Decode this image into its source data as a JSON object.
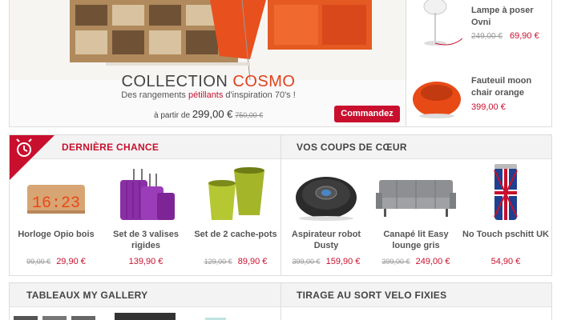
{
  "hero": {
    "title_plain": "COLLECTION ",
    "title_accent": "COSMO",
    "subtitle_1": "Des rangements ",
    "subtitle_hl": "pétillants",
    "subtitle_2": " d'inspiration 70's !",
    "price_prefix": "à partir de ",
    "price": "299,00 €",
    "old_price": "750,00 €",
    "order_label": "Commandez"
  },
  "side_products": [
    {
      "name": "Lampe à poser Ovni",
      "old_price": "249,00 €",
      "price": "69,90 €"
    },
    {
      "name": "Fauteuil moon chair orange",
      "old_price": "",
      "price": "399,00 €"
    }
  ],
  "last_chance": {
    "title": "DERNIÈRE CHANCE",
    "products": [
      {
        "name": "Horloge Opio bois",
        "old_price": "99,00 €",
        "price": "29,90 €",
        "display": "16:23"
      },
      {
        "name": "Set de 3 valises rigides",
        "old_price": "",
        "price": "139,90 €"
      },
      {
        "name": "Set de 2 cache-pots",
        "old_price": "129,00 €",
        "price": "89,90 €"
      }
    ]
  },
  "favorites": {
    "title": "VOS COUPS DE CŒUR",
    "products": [
      {
        "name": "Aspirateur robot Dusty",
        "old_price": "399,00 €",
        "price": "159,90 €"
      },
      {
        "name": "Canapé lit Easy lounge gris",
        "old_price": "399,00 €",
        "price": "249,00 €"
      },
      {
        "name": "No Touch pschitt UK",
        "old_price": "",
        "price": "54,90 €"
      }
    ]
  },
  "gallery": {
    "title": "TABLEAUX MY GALLERY"
  },
  "draw": {
    "title": "TIRAGE AU SORT VELO FIXIES"
  },
  "colors": {
    "accent": "#c8102e",
    "orange": "#e8501e",
    "border": "#dddddd"
  }
}
